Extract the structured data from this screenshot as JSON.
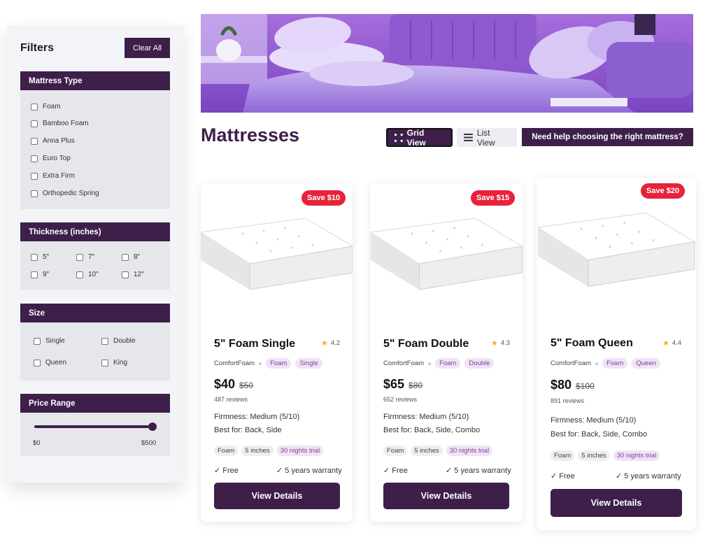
{
  "sidebar": {
    "title": "Filters",
    "clear_label": "Clear All",
    "mattress_type": {
      "heading": "Mattress Type",
      "options": [
        "Foam",
        "Bamboo Foam",
        "Anna Plus",
        "Euro Top",
        "Extra Firm",
        "Orthopedic Spring"
      ]
    },
    "thickness": {
      "heading": "Thickness (inches)",
      "options": [
        "5\"",
        "7\"",
        "8\"",
        "9\"",
        "10\"",
        "12\""
      ]
    },
    "size": {
      "heading": "Size",
      "options": [
        "Single",
        "Double",
        "Queen",
        "King"
      ]
    },
    "price_range": {
      "heading": "Price Range",
      "min_label": "$0",
      "max_label": "$500",
      "value_fraction": 1.0
    }
  },
  "main": {
    "title": "Mattresses",
    "grid_view_label": "Grid View",
    "list_view_label": "List View",
    "help_label": "Need help choosing the right mattress?"
  },
  "products": [
    {
      "badge": "Save $10",
      "name": "5\" Foam Single",
      "rating": "4.2",
      "brand": "ComfortFoam",
      "chips": [
        "Foam",
        "Single"
      ],
      "price": "$40",
      "old_price": "$50",
      "reviews": "487 reviews",
      "firmness": "Firmness:  Medium (5/10)",
      "best_for": "Best for:  Back, Side",
      "tags": [
        "Foam",
        "5 inches",
        "30 nights trial"
      ],
      "perk_left": "✓ Free",
      "perk_right": "✓ 5 years warranty",
      "button": "View Details"
    },
    {
      "badge": "Save $15",
      "name": "5\" Foam Double",
      "rating": "4.3",
      "brand": "ComfortFoam",
      "chips": [
        "Foam",
        "Double"
      ],
      "price": "$65",
      "old_price": "$80",
      "reviews": "652 reviews",
      "firmness": "Firmness:  Medium (5/10)",
      "best_for": "Best for:  Back, Side, Combo",
      "tags": [
        "Foam",
        "5 inches",
        "30 nights trial"
      ],
      "perk_left": "✓ Free",
      "perk_right": "✓ 5 years warranty",
      "button": "View Details"
    },
    {
      "badge": "Save $20",
      "name": "5\" Foam Queen",
      "rating": "4.4",
      "brand": "ComfortFoam",
      "chips": [
        "Foam",
        "Queen"
      ],
      "price": "$80",
      "old_price": "$100",
      "reviews": "891 reviews",
      "firmness": "Firmness:  Medium (5/10)",
      "best_for": "Best for:  Back, Side, Combo",
      "tags": [
        "Foam",
        "5 inches",
        "30 nights trial"
      ],
      "perk_left": "✓ Free",
      "perk_right": "✓ 5 years warranty",
      "button": "View Details"
    }
  ],
  "colors": {
    "brand": "#3d1f4a",
    "sale": "#e6233a",
    "star": "#f2b01e",
    "chip_bg": "#efe3f5",
    "chip_text": "#7d3f9a"
  }
}
